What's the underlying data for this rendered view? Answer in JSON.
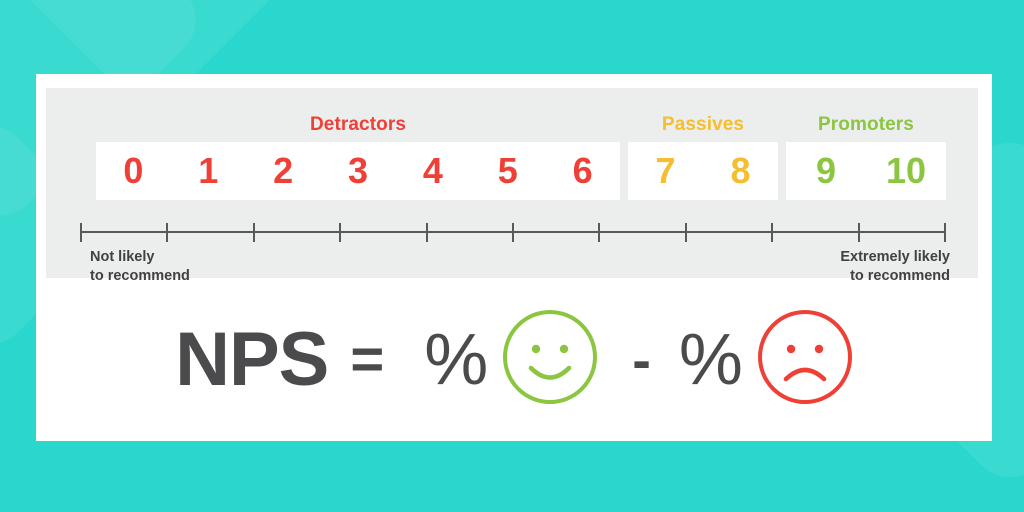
{
  "theme": {
    "background_teal": "#2ad7cd",
    "card_white": "#ffffff",
    "panel_gray": "#eceded",
    "detractor_red": "#ee4036",
    "passive_yellow": "#f5be2e",
    "promoter_green": "#8cc540",
    "text_dark": "#4b4b4d",
    "axis_gray": "#58595b"
  },
  "scale": {
    "groups": [
      {
        "label": "Detractors",
        "color": "#ee4036",
        "values": [
          "0",
          "1",
          "2",
          "3",
          "4",
          "5",
          "6"
        ]
      },
      {
        "label": "Passives",
        "color": "#f5be2e",
        "values": [
          "7",
          "8"
        ]
      },
      {
        "label": "Promoters",
        "color": "#8cc540",
        "values": [
          "9",
          "10"
        ]
      }
    ],
    "tick_count": 11,
    "endpoints": {
      "left": "Not likely\nto recommend",
      "right": "Extremely likely\nto recommend"
    }
  },
  "formula": {
    "title": "NPS",
    "equals": "=",
    "minus": "-",
    "percent_promoters": "%",
    "percent_detractors": "%",
    "happy_face_icon": "happy-face-icon",
    "sad_face_icon": "sad-face-icon"
  }
}
